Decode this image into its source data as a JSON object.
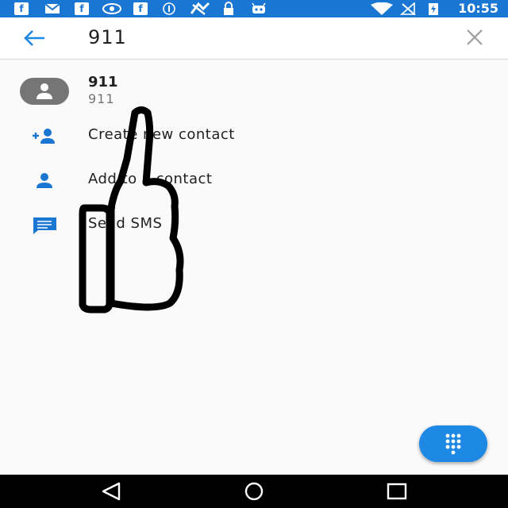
{
  "status_bar": {
    "time": "10:55",
    "background": "#1976d2",
    "left_icons": [
      "facebook-icon",
      "mail-icon",
      "facebook-icon",
      "nvidia-icon",
      "facebook-icon",
      "circle-info-icon",
      "sync-icon",
      "lock-icon",
      "android-icon"
    ],
    "right_icons": [
      "wifi-icon",
      "no-signal-icon",
      "battery-charging-icon"
    ]
  },
  "search": {
    "query": "911",
    "back_icon": "arrow-left-icon",
    "clear_icon": "close-icon"
  },
  "results": {
    "contact": {
      "name": "911",
      "number": "911",
      "icon": "person-avatar-icon"
    },
    "actions": [
      {
        "label": "Create new contact",
        "icon": "person-add-icon"
      },
      {
        "label": "Add to a contact",
        "icon": "person-icon"
      },
      {
        "label": "Send SMS",
        "icon": "message-icon"
      }
    ]
  },
  "fab": {
    "icon": "dialpad-icon",
    "color": "#1e88e5"
  },
  "nav_bar": {
    "buttons": [
      "back-triangle-icon",
      "home-circle-icon",
      "recents-square-icon"
    ]
  },
  "colors": {
    "accent": "#1e88e5",
    "icon_blue": "#1976d2"
  }
}
